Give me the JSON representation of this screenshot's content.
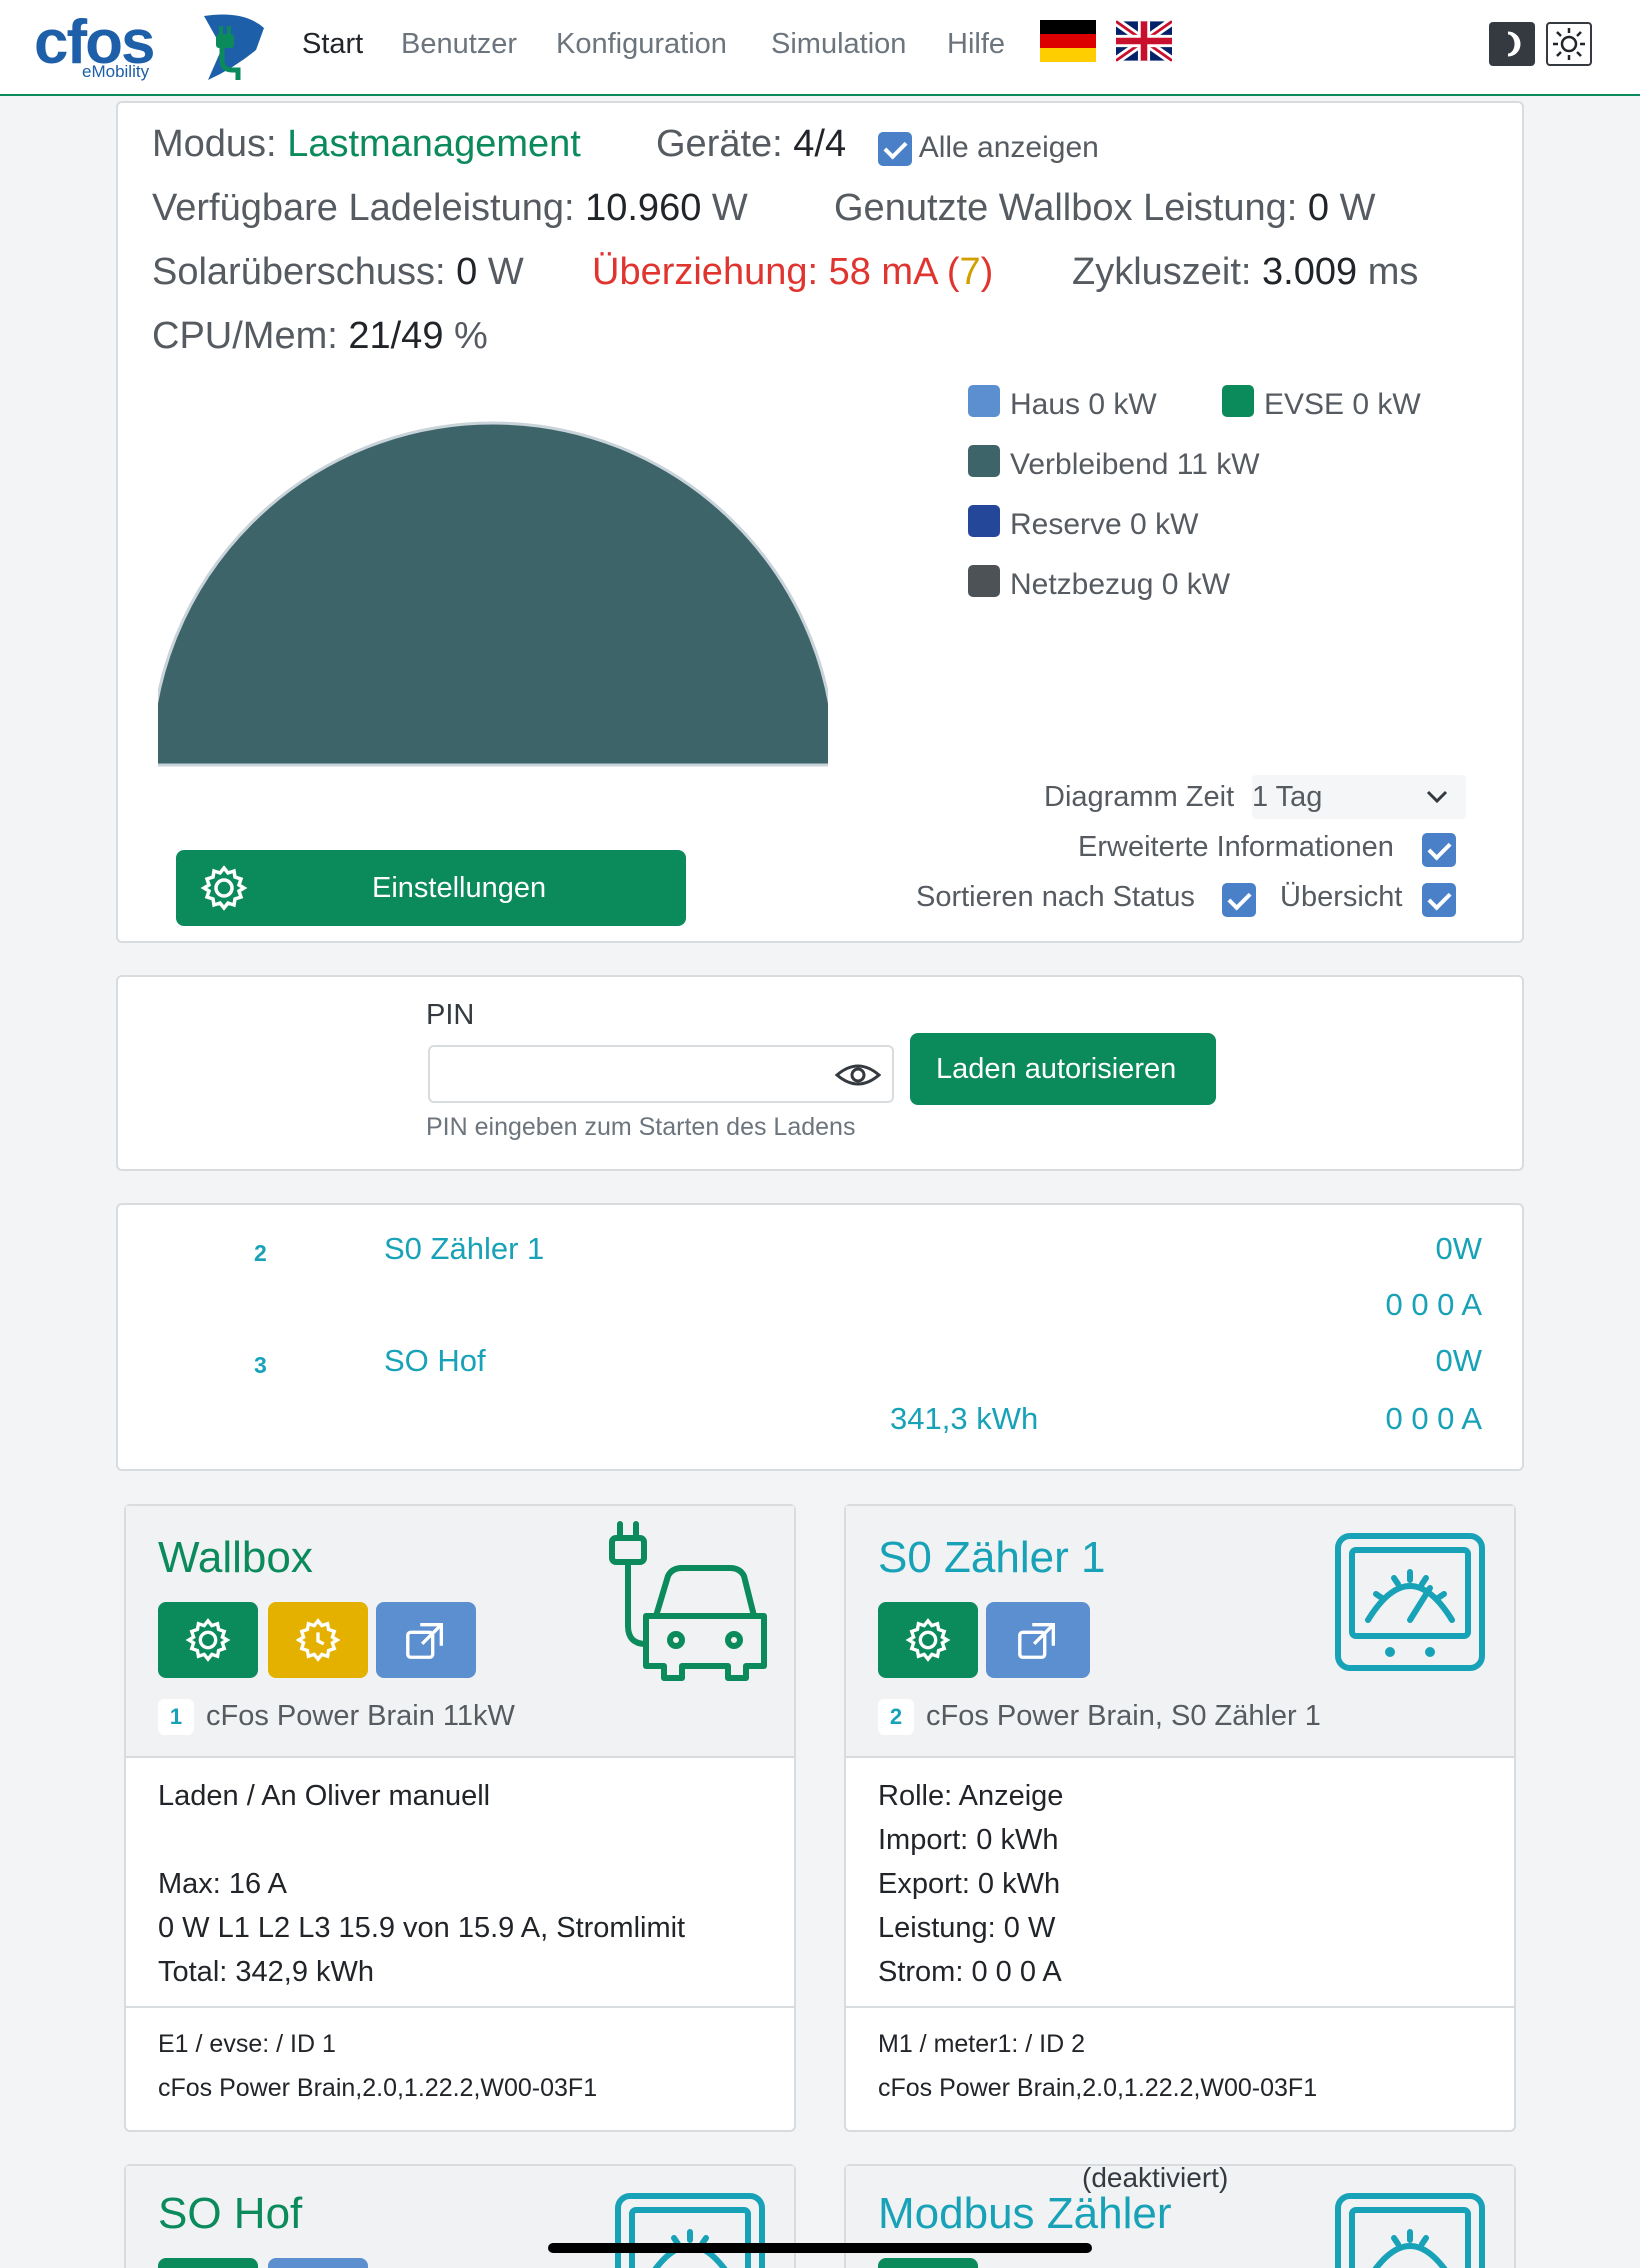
{
  "logo": {
    "word": "cfos",
    "sub": "eMobility"
  },
  "nav": {
    "items": [
      "Start",
      "Benutzer",
      "Konfiguration",
      "Simulation",
      "Hilfe"
    ],
    "active": "Start"
  },
  "status": {
    "mode_label": "Modus:",
    "mode_value": "Lastmanagement",
    "devices_label": "Geräte:",
    "devices_value": "4/4",
    "show_all_label": "Alle anzeigen",
    "avail_label": "Verfügbare Ladeleistung:",
    "avail_value": "10.960",
    "avail_unit": "W",
    "used_label": "Genutzte Wallbox Leistung:",
    "used_value": "0",
    "used_unit": "W",
    "solar_label": "Solarüberschuss:",
    "solar_value": "0",
    "solar_unit": "W",
    "overdraw_label": "Überziehung: 58 mA (",
    "overdraw_count": "7",
    "overdraw_close": ")",
    "cycle_label": "Zykluszeit:",
    "cycle_value": "3.009",
    "cycle_unit": "ms",
    "cpu_label": "CPU/Mem:",
    "cpu_value": "21/49",
    "cpu_unit": "%"
  },
  "chart_data": {
    "type": "pie",
    "categories": [
      "Haus",
      "EVSE",
      "Verbleibend",
      "Reserve",
      "Netzbezug"
    ],
    "values": [
      0,
      0,
      11,
      0,
      0
    ],
    "unit": "kW",
    "colors": [
      "#5b8fd0",
      "#0b8a5c",
      "#3d6469",
      "#24479a",
      "#4d5257"
    ],
    "legend_labels": [
      "Haus 0 kW",
      "EVSE 0 kW",
      "Verbleibend 11 kW",
      "Reserve 0 kW",
      "Netzbezug 0 kW"
    ],
    "shape": "half-donut",
    "legend_position": "right"
  },
  "options": {
    "diagram_time_label": "Diagramm Zeit",
    "diagram_time_value": "1 Tag",
    "extended_info_label": "Erweiterte Informationen",
    "sort_label": "Sortieren nach Status",
    "overview_label": "Übersicht",
    "settings_button": "Einstellungen"
  },
  "pin": {
    "label": "PIN",
    "value": "",
    "help": "PIN eingeben zum Starten des Ladens",
    "button": "Laden autorisieren"
  },
  "meters": [
    {
      "id": "2",
      "name": "S0 Zähler 1",
      "power": "0W",
      "energy": "",
      "current": "0 0 0 A"
    },
    {
      "id": "3",
      "name": "SO Hof",
      "power": "0W",
      "energy": "341,3 kWh",
      "current": "0 0 0 A"
    }
  ],
  "devices": [
    {
      "title": "Wallbox",
      "id": "1",
      "model": "cFos Power Brain 11kW",
      "lines": [
        "Laden / An Oliver manuell",
        "",
        "Max: 16 A",
        "0 W L1 L2 L3 15.9 von 15.9 A, Stromlimit",
        "Total: 342,9 kWh"
      ],
      "foot": [
        "E1 / evse: / ID 1",
        "cFos Power Brain,2.0,1.22.2,W00-03F1"
      ]
    },
    {
      "title": "S0 Zähler 1",
      "id": "2",
      "model": "cFos Power Brain, S0 Zähler 1",
      "lines": [
        "Rolle: Anzeige",
        "Import: 0 kWh",
        "Export: 0 kWh",
        "Leistung: 0 W",
        "Strom: 0 0 0 A"
      ],
      "foot": [
        "M1 / meter1: / ID 2",
        "cFos Power Brain,2.0,1.22.2,W00-03F1"
      ]
    },
    {
      "title": "SO Hof"
    },
    {
      "title": "Modbus Zähler",
      "note": "(deaktiviert)"
    }
  ]
}
